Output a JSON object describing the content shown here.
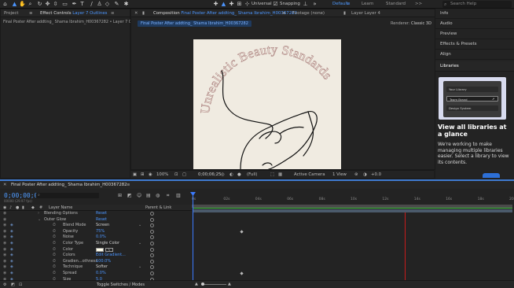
{
  "toolbar": {
    "workspaces": [
      "Default",
      "Learn",
      "Standard"
    ],
    "workspace_active": "Default",
    "universal_label": "Universal",
    "snapping_label": "Snapping",
    "search_placeholder": "Search Help",
    "more_label": ">>"
  },
  "project_panel": {
    "tab_project": "Project",
    "tab_effect_controls_prefix": "Effect Controls",
    "tab_effect_controls_layer": "Layer 7 Outlines",
    "breadcrumb": "Final Poster After addting_ Shama Ibrahim_H00367282 • Layer 7 Outline"
  },
  "comp_panel": {
    "tab_composition_prefix": "Composition",
    "tab_composition_name": "Final Poster After addting_ Shama Ibrahim_H00367282",
    "tab_footage": "Footage (none)",
    "tab_layer": "Layer Layer 4",
    "comp_chip": "Final Poster After addting_ Shama Ibrahim_H00367282",
    "renderer_label": "Renderer:",
    "renderer_value": "Classic 3D",
    "canvas_title": "Unrealistic Beauty Standards",
    "footer": {
      "zoom": "100%",
      "timecode": "0;00;06;25",
      "resolution": "(Full)",
      "camera": "Active Camera",
      "views": "1 View",
      "exposure": "+0.0"
    }
  },
  "right_panel": {
    "items": [
      "Info",
      "Audio",
      "Preview",
      "Effects & Presets",
      "Align",
      "Libraries"
    ],
    "library_rows": [
      "Your Library",
      "Team Brand",
      "Design System"
    ],
    "library_title": "View all libraries at a glance",
    "library_body": "We're working to make managing multiple libraries easier. Select a library to view its contents."
  },
  "timeline": {
    "tab_name": "Final Poster After addting_ Shama Ibrahim_H00367282",
    "timecode": "0;00;00;00",
    "timecode_sub": "00000 (29.97 fps)",
    "col_layer_name": "Layer Name",
    "col_parent": "Parent & Link",
    "ruler_labels": [
      "0s",
      "02s",
      "04s",
      "06s",
      "08s",
      "10s",
      "12s",
      "14s",
      "16s",
      "18s",
      "20s"
    ],
    "toggle_label": "Toggle Switches / Modes",
    "rows": [
      {
        "name": "Blending Options",
        "value": "Reset",
        "blue": true,
        "indent": 0,
        "expander": true
      },
      {
        "name": "Outer Glow",
        "value": "Reset",
        "blue": true,
        "indent": 0,
        "expander": true
      },
      {
        "name": "Blend Mode",
        "value": "Screen",
        "blue": false,
        "indent": 1,
        "dropdown": true
      },
      {
        "name": "Opacity",
        "value": "75%",
        "blue": true,
        "indent": 1
      },
      {
        "name": "Noise",
        "value": "0.0%",
        "blue": true,
        "indent": 1
      },
      {
        "name": "Color Type",
        "value": "Single Color",
        "blue": false,
        "indent": 1,
        "dropdown": true
      },
      {
        "name": "Color",
        "value": "",
        "blue": false,
        "indent": 1,
        "swatch": true
      },
      {
        "name": "Colors",
        "value": "Edit Gradient...",
        "blue": true,
        "indent": 1
      },
      {
        "name": "Gradien...othness",
        "value": "100.0%",
        "blue": true,
        "indent": 1
      },
      {
        "name": "Technique",
        "value": "Softer",
        "blue": false,
        "indent": 1,
        "dropdown": true
      },
      {
        "name": "Spread",
        "value": "0.0%",
        "blue": true,
        "indent": 1
      },
      {
        "name": "Size",
        "value": "5.0",
        "blue": true,
        "indent": 1
      }
    ]
  },
  "colors": {
    "accent": "#4c96ff",
    "canvas": "#f0ebe1",
    "playhead": "#3b7bff",
    "end_marker": "#c81b1b",
    "work_bar": "#3fbf3f",
    "title_text": "#b08a86",
    "swatch_color": "#fffde8"
  }
}
